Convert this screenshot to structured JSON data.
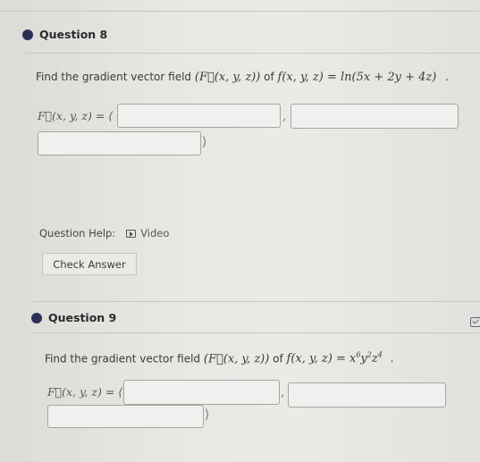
{
  "question8": {
    "title": "Question 8",
    "prompt_prefix": "Find the gradient vector field",
    "field_notation": "(F⃗(x, y, z))",
    "prompt_of": "of",
    "function": "f(x, y, z) = ln(5x + 2y + 4z)",
    "period": ".",
    "answer_label": "F⃗(x, y, z) = ⟨",
    "comp1": "",
    "comp2": "",
    "comp3": "",
    "separator": ",",
    "close": "⟩",
    "help_label": "Question Help:",
    "video_label": "Video",
    "check_button": "Check Answer"
  },
  "question9": {
    "title": "Question 9",
    "prompt_prefix": "Find the gradient vector field",
    "field_notation": "(F⃗(x, y, z))",
    "prompt_of": "of",
    "function_base": "f(x, y, z) = x",
    "exp_x": "6",
    "y_var": "y",
    "exp_y": "2",
    "z_var": "z",
    "exp_z": "4",
    "period": ".",
    "answer_label": "F⃗(x, y, z) = ⟨",
    "comp1": "",
    "comp2": "",
    "comp3": "",
    "separator": ",",
    "close": "⟩"
  },
  "colors": {
    "bullet": "#2b2f55",
    "background": "#e4e3e1",
    "box_border": "#a7a5a2"
  },
  "icons": {
    "bullet": "filled-circle",
    "video": "play-box-icon",
    "side": "checkbox-icon"
  }
}
